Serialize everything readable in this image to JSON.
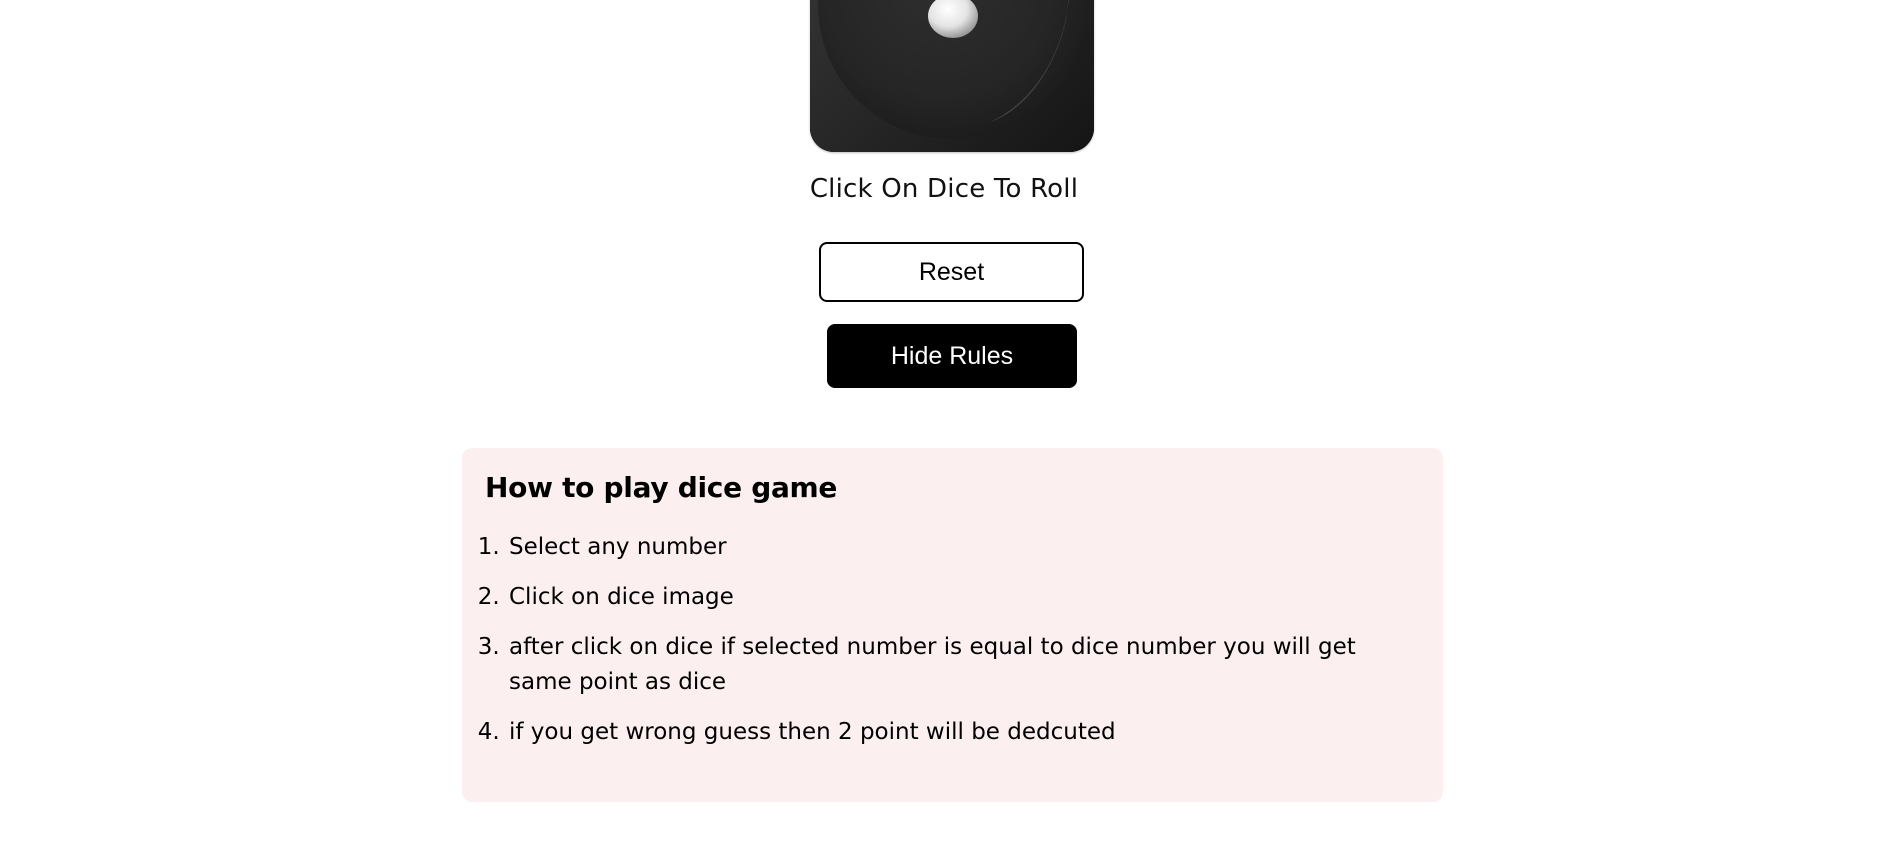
{
  "dice": {
    "icon": "dice-face-icon",
    "colors": {
      "body": "#222222",
      "pip": "#e9e9e9"
    }
  },
  "caption": "Click On Dice To Roll",
  "buttons": {
    "reset_label": "Reset",
    "hide_rules_label": "Hide Rules"
  },
  "rules": {
    "title": "How to play dice game",
    "items": [
      "Select any number",
      "Click on dice image",
      "after click on dice if selected number is equal to dice number you will get same point as dice",
      "if you get wrong guess then 2 point will be dedcuted"
    ],
    "background": "#fbf0ef"
  }
}
